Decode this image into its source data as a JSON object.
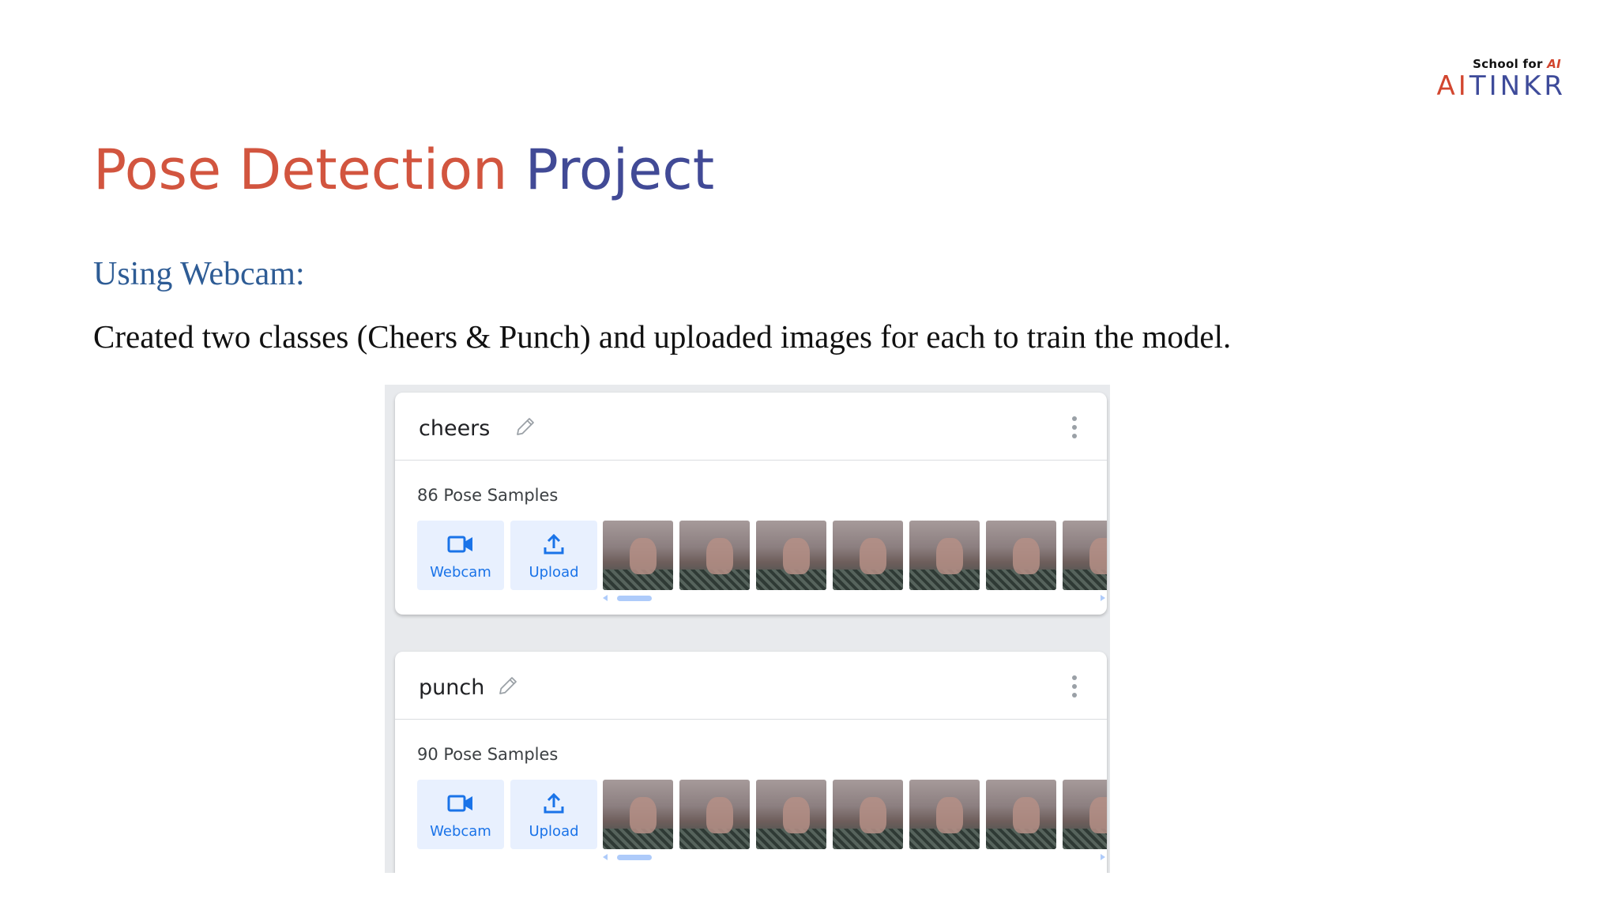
{
  "logo": {
    "school_text": "School for",
    "school_ai": "AI",
    "brand_ai": "AI",
    "brand_rest": "TINKR"
  },
  "slide": {
    "title_part1": "Pose Detection",
    "title_part2": "Project",
    "subheading": "Using Webcam:",
    "description": "Created two classes (Cheers & Punch) and uploaded images for each to train the model."
  },
  "classes": [
    {
      "name": "cheers",
      "samples": "86 Pose Samples",
      "webcam_label": "Webcam",
      "upload_label": "Upload"
    },
    {
      "name": "punch",
      "samples": "90 Pose Samples",
      "webcam_label": "Webcam",
      "upload_label": "Upload"
    }
  ],
  "colors": {
    "title_red": "#d2553f",
    "title_blue": "#414a96",
    "accent": "#1a73e8",
    "button_bg": "#e8f0fe"
  },
  "icons": {
    "webcam": "videocam-icon",
    "upload": "upload-icon",
    "edit": "pencil-icon",
    "menu": "more-vert-icon"
  }
}
